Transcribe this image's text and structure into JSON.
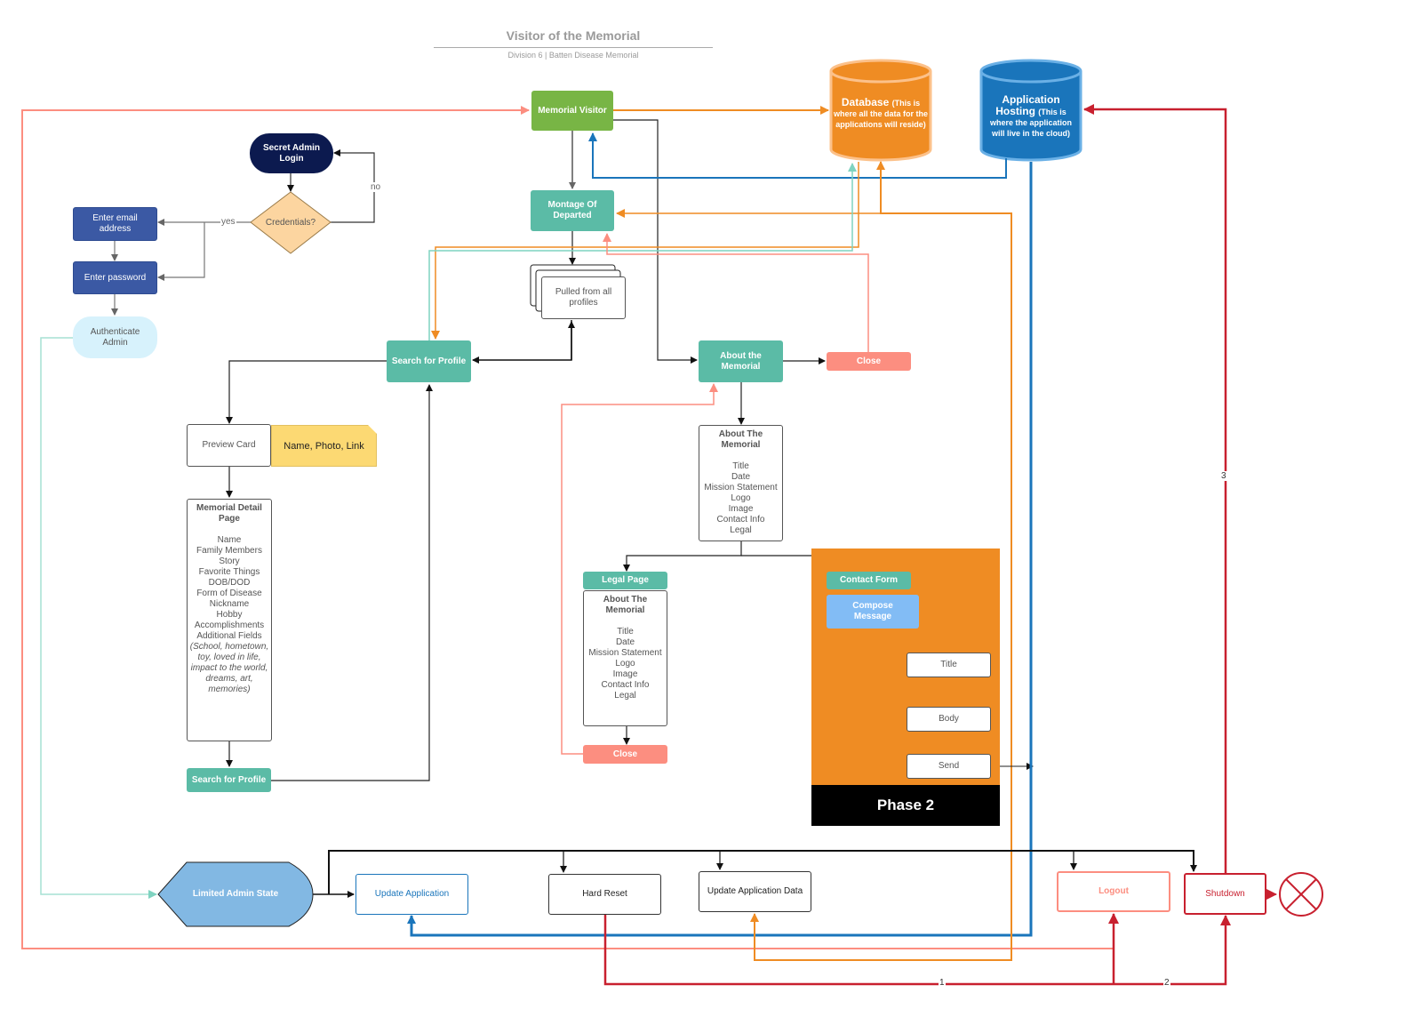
{
  "header": {
    "title": "Visitor of the Memorial",
    "subtitle": "Division 6 | Batten Disease Memorial"
  },
  "nodes": {
    "memorial_visitor": "Memorial Visitor",
    "montage": "Montage Of Departed",
    "pulled_profiles": "Pulled from all profiles",
    "search_profile_top": "Search for Profile",
    "search_profile_bottom": "Search for Profile",
    "about_memorial": "About the Memorial",
    "close_top": "Close",
    "close_bottom": "Close",
    "preview_card": "Preview Card",
    "preview_note": "Name, Photo, Link",
    "secret_admin_login": "Secret Admin Login",
    "credentials": "Credentials?",
    "enter_email": "Enter email address",
    "enter_password": "Enter password",
    "authenticate_admin": "Authenticate Admin",
    "legal_page": "Legal Page",
    "contact_form": "Contact Form",
    "compose_message": "Compose Message",
    "form_title": "Title",
    "form_body": "Body",
    "form_send": "Send",
    "phase": "Phase 2",
    "limited_admin_state": "Limited Admin State",
    "update_application": "Update Application",
    "hard_reset": "Hard Reset",
    "update_application_data": "Update Application Data",
    "logout": "Logout",
    "shutdown": "Shutdown"
  },
  "database": {
    "title": "Database",
    "desc": "(This is where all the data for the applications will reside)"
  },
  "hosting": {
    "title": "Application Hosting",
    "desc": "(This is where the application will live in the cloud)"
  },
  "memorial_detail": {
    "heading": "Memorial Detail Page",
    "items": [
      "Name",
      "Family Members",
      "Story",
      "Favorite Things",
      "DOB/DOD",
      "Form of Disease",
      "Nickname",
      "Hobby",
      "Accomplishments",
      "Additional Fields"
    ],
    "italic_note": "(School, hometown, toy, loved in life, impact to the world, dreams, art, memories)"
  },
  "about_list": {
    "heading": "About The Memorial",
    "items": [
      "Title",
      "Date",
      "Mission Statement",
      "Logo",
      "Image",
      "Contact Info",
      "Legal"
    ]
  },
  "legal_list": {
    "heading": "About The Memorial",
    "items": [
      "Title",
      "Date",
      "Mission Statement",
      "Logo",
      "Image",
      "Contact Info",
      "Legal"
    ]
  },
  "edge_labels": {
    "yes": "yes",
    "no": "no",
    "one": "1",
    "two": "2",
    "three": "3"
  },
  "colors": {
    "teal": "#5bbba6",
    "green": "#78b545",
    "orange": "#ef8c23",
    "blue": "#1a75bb",
    "salmon": "#fc8e80",
    "red": "#c8202f",
    "navy": "#0c1a4f"
  }
}
